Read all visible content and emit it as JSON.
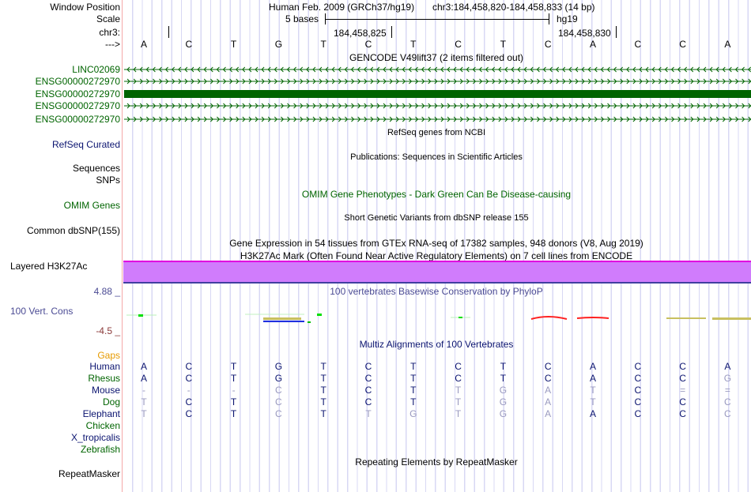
{
  "header": {
    "window_position_label": "Window Position",
    "scale_label": "Scale",
    "chr_label": "chr3:",
    "strand_label": "--->",
    "assembly": "Human Feb. 2009 (GRCh37/hg19)",
    "position": "chr3:184,458,820-184,458,833 (14 bp)",
    "scale_text": "5 bases",
    "db": "hg19",
    "ticks": [
      "184,458,825",
      "184,458,830"
    ]
  },
  "bases": [
    "A",
    "C",
    "T",
    "G",
    "T",
    "C",
    "T",
    "C",
    "T",
    "C",
    "A",
    "C",
    "C",
    "A"
  ],
  "tracks": {
    "gencode_title": "GENCODE V49lift37 (2 items filtered out)",
    "genes": [
      {
        "name": "LINC02069",
        "strand": "-"
      },
      {
        "name": "ENSG00000272970",
        "strand": "+"
      },
      {
        "name": "ENSG00000272970",
        "strand": "block"
      },
      {
        "name": "ENSG00000272970",
        "strand": "+"
      },
      {
        "name": "ENSG00000272970",
        "strand": "+"
      }
    ],
    "refseq_title": "RefSeq genes from NCBI",
    "refseq_label": "RefSeq Curated",
    "pubs_title": "Publications: Sequences in Scientific Articles",
    "sequences_label": "Sequences",
    "snps_label": "SNPs",
    "omim_title": "OMIM Gene Phenotypes - Dark Green Can Be Disease-causing",
    "omim_label": "OMIM Genes",
    "dbsnp_title": "Short Genetic Variants from dbSNP release 155",
    "dbsnp_label": "Common dbSNP(155)",
    "gtex_title": "Gene Expression in 54 tissues from GTEx RNA-seq of 17382 samples, 948 donors (V8, Aug 2019)",
    "h3k_title": "H3K27Ac Mark (Often Found Near Active Regulatory Elements) on 7 cell lines from ENCODE",
    "h3k_label": "Layered H3K27Ac",
    "phylop_title": "100 vertebrates Basewise Conservation by PhyloP",
    "phylop_label": "100 Vert. Cons",
    "phylop_max": "4.88 _",
    "phylop_min": "-4.5 _",
    "multiz_title": "Multiz Alignments of 100 Vertebrates",
    "gaps_label": "Gaps",
    "alignments": [
      {
        "species": "Human",
        "seq": [
          "A",
          "C",
          "T",
          "G",
          "T",
          "C",
          "T",
          "C",
          "T",
          "C",
          "A",
          "C",
          "C",
          "A"
        ]
      },
      {
        "species": "Rhesus",
        "seq": [
          "A",
          "C",
          "T",
          "G",
          "T",
          "C",
          "T",
          "C",
          "T",
          "C",
          "A",
          "C",
          "C",
          "G"
        ]
      },
      {
        "species": "Mouse",
        "seq": [
          "-",
          "-",
          "-",
          "C",
          "T",
          "C",
          "T",
          "T",
          "G",
          "A",
          "T",
          "C",
          "=",
          "="
        ]
      },
      {
        "species": "Dog",
        "seq": [
          "T",
          "C",
          "T",
          "C",
          "T",
          "C",
          "T",
          "T",
          "G",
          "A",
          "T",
          "C",
          "C",
          "C"
        ]
      },
      {
        "species": "Elephant",
        "seq": [
          "T",
          "C",
          "T",
          "C",
          "T",
          "T",
          "G",
          "T",
          "G",
          "A",
          "A",
          "C",
          "C",
          "C"
        ]
      },
      {
        "species": "Chicken",
        "seq": []
      },
      {
        "species": "X_tropicalis",
        "seq": []
      },
      {
        "species": "Zebrafish",
        "seq": []
      }
    ],
    "rmsk_title": "Repeating Elements by RepeatMasker",
    "rmsk_label": "RepeatMasker"
  },
  "colors": {
    "gene": "#006400",
    "navy": "#0b1470",
    "h3k_fill": "#d07cfc",
    "h3k_top": "#e000e0",
    "gaps": "#e69a00",
    "phylop_min": "#8b3a3a",
    "mismatch": "#9a9ac0"
  }
}
